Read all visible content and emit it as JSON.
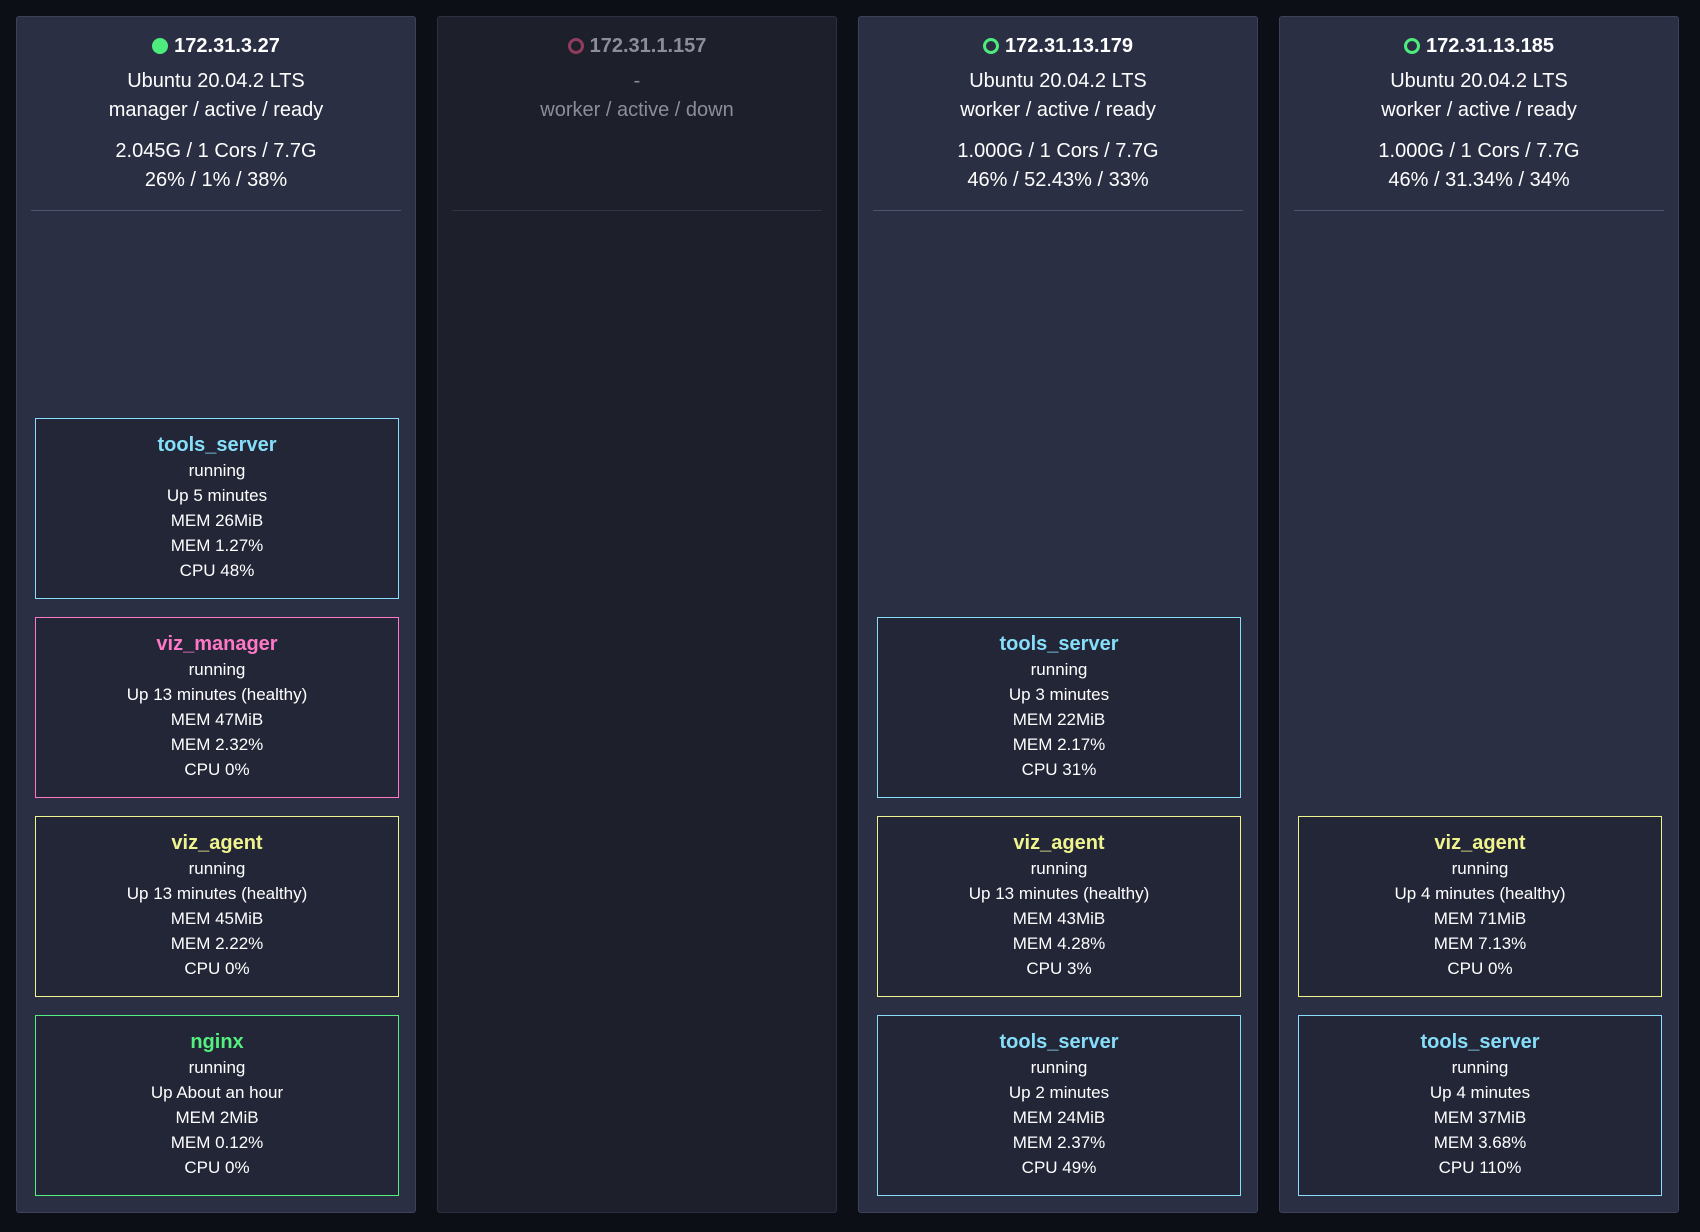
{
  "colors": {
    "tools_server": "#86defa",
    "viz_manager": "#ff78c6",
    "viz_agent": "#f0f48c",
    "nginx": "#52f07c",
    "status_ready": "#4eeb7d",
    "status_down": "#8f3d5e"
  },
  "nodes": [
    {
      "ip": "172.31.3.27",
      "status_icon": "filled-circle-icon",
      "os": "Ubuntu 20.04.2 LTS",
      "role": "manager / active / ready",
      "resources": "2.045G / 1 Cors / 7.7G",
      "usage": "26% / 1% / 38%",
      "tasks": [
        {
          "name": "tools_server",
          "kind": "tools_server",
          "state": "running",
          "uptime": "Up 5 minutes",
          "mem": "MEM 26MiB",
          "mem_pct": "MEM 1.27%",
          "cpu": "CPU 48%"
        },
        {
          "name": "viz_manager",
          "kind": "viz_manager",
          "state": "running",
          "uptime": "Up 13 minutes (healthy)",
          "mem": "MEM 47MiB",
          "mem_pct": "MEM 2.32%",
          "cpu": "CPU 0%"
        },
        {
          "name": "viz_agent",
          "kind": "viz_agent",
          "state": "running",
          "uptime": "Up 13 minutes (healthy)",
          "mem": "MEM 45MiB",
          "mem_pct": "MEM 2.22%",
          "cpu": "CPU 0%"
        },
        {
          "name": "nginx",
          "kind": "nginx",
          "state": "running",
          "uptime": "Up About an hour",
          "mem": "MEM 2MiB",
          "mem_pct": "MEM 0.12%",
          "cpu": "CPU 0%"
        }
      ]
    },
    {
      "ip": "172.31.1.157",
      "status_icon": "ring-circle-icon",
      "os": "-",
      "role": "worker / active / down",
      "resources": "",
      "usage": "",
      "tasks": []
    },
    {
      "ip": "172.31.13.179",
      "status_icon": "ring-circle-icon",
      "os": "Ubuntu 20.04.2 LTS",
      "role": "worker / active / ready",
      "resources": "1.000G / 1 Cors / 7.7G",
      "usage": "46% / 52.43% / 33%",
      "tasks": [
        {
          "name": "tools_server",
          "kind": "tools_server",
          "state": "running",
          "uptime": "Up 3 minutes",
          "mem": "MEM 22MiB",
          "mem_pct": "MEM 2.17%",
          "cpu": "CPU 31%"
        },
        {
          "name": "viz_agent",
          "kind": "viz_agent",
          "state": "running",
          "uptime": "Up 13 minutes (healthy)",
          "mem": "MEM 43MiB",
          "mem_pct": "MEM 4.28%",
          "cpu": "CPU 3%"
        },
        {
          "name": "tools_server",
          "kind": "tools_server",
          "state": "running",
          "uptime": "Up 2 minutes",
          "mem": "MEM 24MiB",
          "mem_pct": "MEM 2.37%",
          "cpu": "CPU 49%"
        }
      ]
    },
    {
      "ip": "172.31.13.185",
      "status_icon": "ring-circle-icon",
      "os": "Ubuntu 20.04.2 LTS",
      "role": "worker / active / ready",
      "resources": "1.000G / 1 Cors / 7.7G",
      "usage": "46% / 31.34% / 34%",
      "tasks": [
        {
          "name": "viz_agent",
          "kind": "viz_agent",
          "state": "running",
          "uptime": "Up 4 minutes (healthy)",
          "mem": "MEM 71MiB",
          "mem_pct": "MEM 7.13%",
          "cpu": "CPU 0%"
        },
        {
          "name": "tools_server",
          "kind": "tools_server",
          "state": "running",
          "uptime": "Up 4 minutes",
          "mem": "MEM 37MiB",
          "mem_pct": "MEM 3.68%",
          "cpu": "CPU 110%"
        }
      ]
    }
  ]
}
